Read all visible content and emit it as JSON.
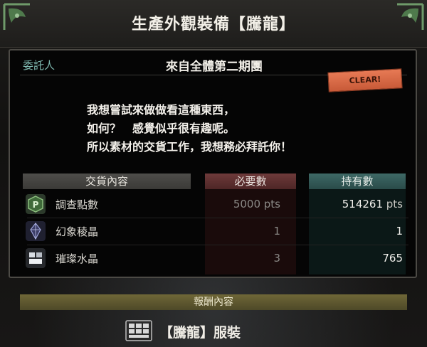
{
  "page": {
    "title": "生產外觀裝備【騰龍】"
  },
  "quest": {
    "client_label": "委託人",
    "client_name": "來自全體第二期團",
    "status_stamp": "CLEAR!",
    "message_lines": [
      "我想嘗試來做做看這種東西，",
      "如何？　感覺似乎很有趣呢。",
      "所以素材的交貨工作，我想務必拜託你！"
    ]
  },
  "table": {
    "headers": {
      "items": "交貨內容",
      "required": "必要數",
      "owned": "持有數"
    },
    "rows": [
      {
        "icon": "research-points-icon",
        "name": "調查點數",
        "required": "5000",
        "required_unit": "pts",
        "owned": "514261",
        "owned_unit": "pts"
      },
      {
        "icon": "phantom-crystal-icon",
        "name": "幻象稜晶",
        "required": "1",
        "required_unit": "",
        "owned": "1",
        "owned_unit": ""
      },
      {
        "icon": "bright-crystal-icon",
        "name": "璀璨水晶",
        "required": "3",
        "required_unit": "",
        "owned": "765",
        "owned_unit": ""
      }
    ]
  },
  "reward": {
    "header": "報酬內容",
    "item_name": "【騰龍】服裝",
    "item_icon": "armor-set-icon"
  },
  "colors": {
    "accent_teal": "#7fb9b0",
    "required_header": "#6e3a3a",
    "owned_header": "#3e6966",
    "clear_stamp": "#e77a55",
    "reward_bar": "#6f6737"
  }
}
